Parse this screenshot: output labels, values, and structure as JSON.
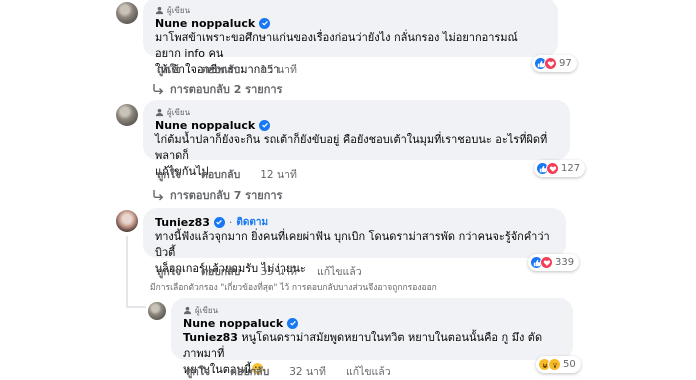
{
  "comments": [
    {
      "author_tag": "ผู้เขียน",
      "name": "Nune noppaluck",
      "lines": [
        "มาโพสข้าเพราะขอศึกษาแก่นของเรื่องก่อนว่ายังไง กลั่นกรอง ไม่อยากอารมณ์ อยาก info คน",
        "ให้เข้าใจอาชีพเรามากกว่า"
      ],
      "like_label": "ถูกใจ",
      "reply_label": "ตอบกลับ",
      "time": "15 นาที",
      "reaction_count": "97",
      "reactions": [
        "like",
        "love"
      ],
      "replies_label": "การตอบกลับ 2 รายการ"
    },
    {
      "author_tag": "ผู้เขียน",
      "name": "Nune noppaluck",
      "lines": [
        "ไก่ต้มน้ำปลาก็ยังจะกิน รถเต้าก็ยังขับอยู่ คือยังชอบเต้าในมุมที่เราชอบนะ อะไรที่ผิดที่พลาดก็",
        "แก้ไขกันไป"
      ],
      "like_label": "ถูกใจ",
      "reply_label": "ตอบกลับ",
      "time": "12 นาที",
      "reaction_count": "127",
      "reactions": [
        "like",
        "love"
      ],
      "replies_label": "การตอบกลับ 7 รายการ"
    },
    {
      "name": "Tuniez83",
      "follow_label": "ติดตาม",
      "lines": [
        "ทางนี้ฟังแล้วจุกมาก ยิ่งคนที่เคยผ่าฟัน บุกเบิก โดนดราม่าสารพัด กว่าคนจะรู้จักคำว่าบิวตี้",
        "บล็อกเกอร์แล้วยอมรับ ไม่ง่ายนะ"
      ],
      "like_label": "ถูกใจ",
      "reply_label": "ตอบกลับ",
      "time": "35 นาที",
      "edited_label": "แก้ไขแล้ว",
      "reaction_count": "339",
      "reactions": [
        "like",
        "love"
      ]
    }
  ],
  "filter_note": "มีการเลือกตัวกรอง \"เกี่ยวข้องที่สุด\" ไว้ การตอบกลับบางส่วนจึงอาจถูกกรองออก",
  "reply": {
    "author_tag": "ผู้เขียน",
    "name": "Nune noppaluck",
    "mention": "Tuniez83",
    "line1_rest": " หนูโดนดราม่าสมัยพูดหยาบในทวิต หยาบในตอนนั้นคือ กู มึง ตัดภาพมาที่",
    "line2": "หยาบในตอนนี้",
    "like_label": "ถูกใจ",
    "reply_label": "ตอบกลับ",
    "time": "32 นาที",
    "edited_label": "แก้ไขแล้ว",
    "reaction_count": "50",
    "reactions": [
      "haha",
      "wow"
    ]
  },
  "colors": {
    "accent": "#1877f2",
    "bubble": "#f0f2f5",
    "muted": "#65676b"
  }
}
